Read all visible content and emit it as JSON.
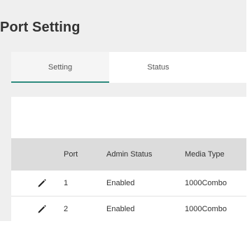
{
  "page": {
    "title": "Port Setting"
  },
  "tabs": [
    {
      "label": "Setting",
      "active": true
    },
    {
      "label": "Status",
      "active": false
    }
  ],
  "table": {
    "columns": [
      "",
      "Port",
      "Admin Status",
      "Media Type"
    ],
    "rows": [
      {
        "port": "1",
        "admin_status": "Enabled",
        "media_type": "1000Combo"
      },
      {
        "port": "2",
        "admin_status": "Enabled",
        "media_type": "1000Combo"
      }
    ]
  },
  "icons": {
    "row_action": "edit-icon"
  },
  "colors": {
    "accent": "#2e8b7e",
    "header_bg": "#dcdcdc",
    "page_bg": "#efefef"
  }
}
